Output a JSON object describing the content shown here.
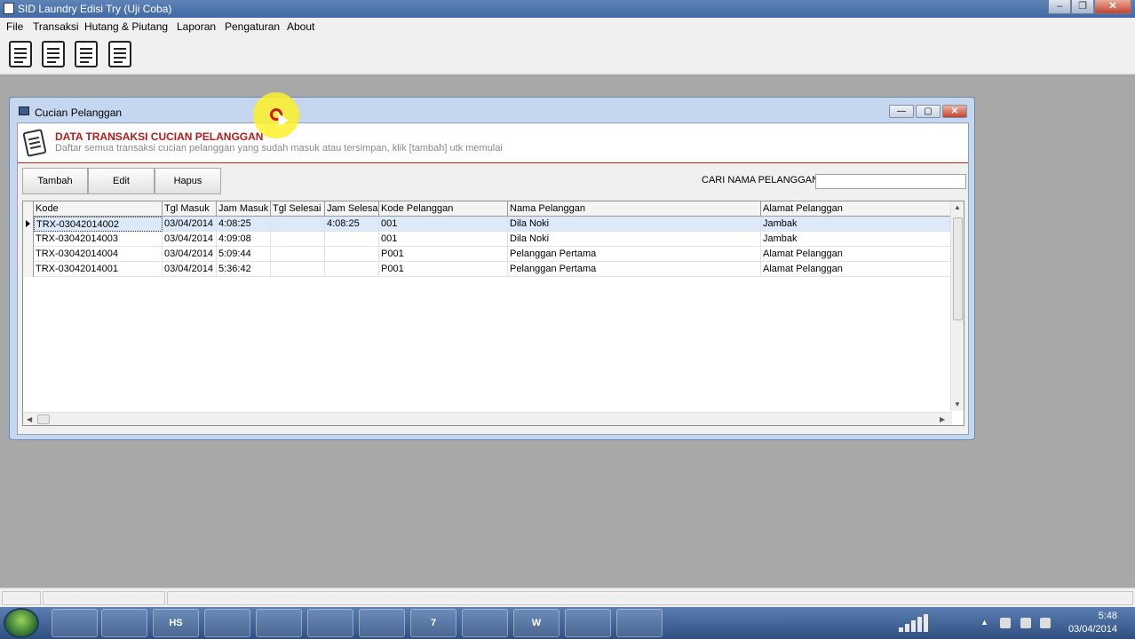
{
  "app": {
    "title": "SID Laundry Edisi Try (Uji Coba)"
  },
  "window_controls": {
    "minimize": "–",
    "restore": "❐",
    "close": "✕"
  },
  "menu": [
    "File",
    "Transaksi",
    "Hutang & Piutang",
    "Laporan",
    "Pengaturan",
    "About"
  ],
  "toolbar": {
    "buttons": [
      "report-icon",
      "report-icon",
      "report-icon",
      "report-icon"
    ]
  },
  "child": {
    "title": "Cucian Pelanggan",
    "controls": {
      "minimize": "—",
      "restore": "▢",
      "close": "✕"
    },
    "header_title": "DATA TRANSAKSI CUCIAN PELANGGAN",
    "header_desc": "Daftar semua transaksi cucian pelanggan yang sudah masuk atau tersimpan, klik [tambah] utk memulai",
    "buttons": {
      "add": "Tambah",
      "edit": "Edit",
      "delete": "Hapus"
    },
    "search_label": "CARI NAMA PELANGGAN",
    "search_value": ""
  },
  "table": {
    "columns": [
      "Kode",
      "Tgl Masuk",
      "Jam Masuk",
      "Tgl Selesai",
      "Jam Selesai",
      "Kode Pelanggan",
      "Nama Pelanggan",
      "Alamat Pelanggan"
    ],
    "rows": [
      [
        "TRX-03042014002",
        "03/04/2014",
        "4:08:25",
        "",
        "4:08:25",
        "001",
        "Dila Noki",
        "Jambak"
      ],
      [
        "TRX-03042014003",
        "03/04/2014",
        "4:09:08",
        "",
        "",
        "001",
        "Dila Noki",
        "Jambak"
      ],
      [
        "TRX-03042014004",
        "03/04/2014",
        "5:09:44",
        "",
        "",
        "P001",
        "Pelanggan Pertama",
        "Alamat Pelanggan"
      ],
      [
        "TRX-03042014001",
        "03/04/2014",
        "5:36:42",
        "",
        "",
        "P001",
        "Pelanggan Pertama",
        "Alamat Pelanggan"
      ]
    ],
    "selected_row": 0
  },
  "taskbar": {
    "buttons": [
      "media-player-icon",
      "powerpoint-icon",
      "hs-icon",
      "folder-icon",
      "laptop-icon",
      "network-icon",
      "box-icon",
      "7-icon",
      "firefox-icon",
      "word-icon",
      "music-icon",
      "laptop-icon"
    ],
    "hs_label": "HS",
    "seven_label": "7",
    "word_label": "W"
  },
  "clock": {
    "time": "5:48",
    "date": "03/04/2014"
  },
  "colors": {
    "header_title": "#b31c1c",
    "selected_row": "#dbe9f8"
  }
}
